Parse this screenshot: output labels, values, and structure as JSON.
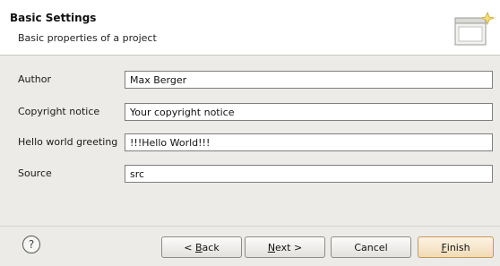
{
  "header": {
    "title": "Basic Settings",
    "description": "Basic properties of a project",
    "icon": "wizard-banner-icon"
  },
  "fields": [
    {
      "label": "Author",
      "value": "Max Berger"
    },
    {
      "label": "Copyright notice",
      "value": "Your copyright notice"
    },
    {
      "label": "Hello world greeting",
      "value": "!!!Hello World!!!"
    },
    {
      "label": "Source",
      "value": "src"
    }
  ],
  "footer": {
    "help_icon": "?",
    "back": {
      "prefix": "< ",
      "mnemonic": "B",
      "rest": "ack"
    },
    "next": {
      "mnemonic": "N",
      "rest": "ext >"
    },
    "cancel": "Cancel",
    "finish": {
      "mnemonic": "F",
      "rest": "inish"
    }
  },
  "colors": {
    "background": "#ecebe8",
    "header": "#ffffff",
    "finish_accent": "#c59a56"
  }
}
